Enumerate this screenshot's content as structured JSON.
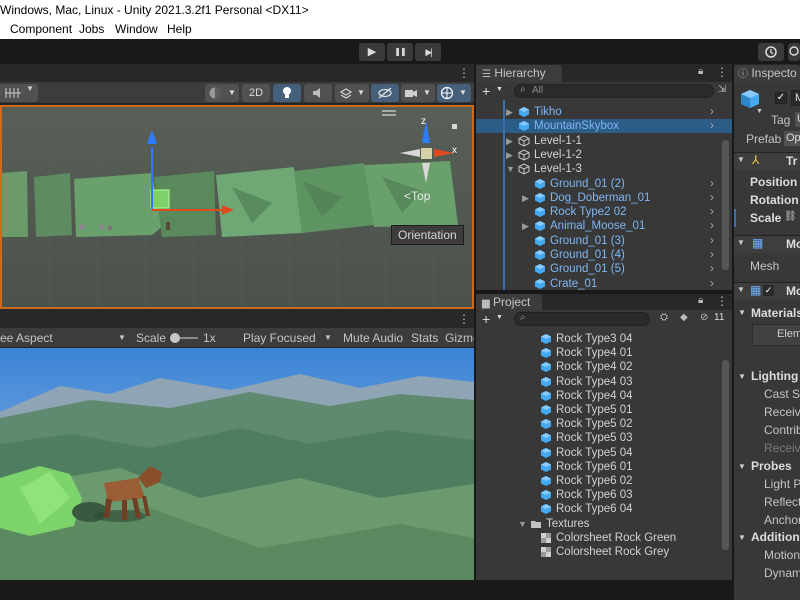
{
  "window": {
    "title": "Windows, Mac, Linux - Unity 2021.3.2f1 Personal <DX11>"
  },
  "menu": {
    "items": [
      "Component",
      "Jobs",
      "Window",
      "Help"
    ]
  },
  "playbar": {
    "play": "▶",
    "pause": "❚❚",
    "step": "▶|"
  },
  "scene": {
    "toggle_2d": "2D",
    "orientation_tooltip": "Orientation",
    "gizmo_top": "Top",
    "axis_z": "z",
    "axis_x": "x"
  },
  "game": {
    "aspect": "ee Aspect",
    "scale_label": "Scale",
    "scale_value": "1x",
    "play_focused": "Play Focused",
    "mute_audio": "Mute Audio",
    "stats": "Stats",
    "gizmos": "Gizmo"
  },
  "hierarchy": {
    "tab": "Hierarchy",
    "search_placeholder": "All",
    "rows": [
      {
        "label": "Tikho",
        "type": "prefab",
        "indent": 2,
        "expand": true,
        "chevron": true
      },
      {
        "label": "MountainSkybox",
        "type": "prefab",
        "indent": 2,
        "expand": false,
        "chevron": true,
        "selected": true
      },
      {
        "label": "Level-1-1",
        "type": "object",
        "indent": 2,
        "expand": true,
        "chevron": false
      },
      {
        "label": "Level-1-2",
        "type": "object",
        "indent": 2,
        "expand": true,
        "chevron": false
      },
      {
        "label": "Level-1-3",
        "type": "object",
        "indent": 2,
        "expand": "open",
        "chevron": false
      },
      {
        "label": "Ground_01 (2)",
        "type": "prefab",
        "indent": 3,
        "expand": false,
        "chevron": true
      },
      {
        "label": "Dog_Doberman_01",
        "type": "prefab",
        "indent": 3,
        "expand": true,
        "chevron": true
      },
      {
        "label": "Rock Type2 02",
        "type": "prefab",
        "indent": 3,
        "expand": false,
        "chevron": true
      },
      {
        "label": "Animal_Moose_01",
        "type": "prefab",
        "indent": 3,
        "expand": true,
        "chevron": true
      },
      {
        "label": "Ground_01 (3)",
        "type": "prefab",
        "indent": 3,
        "expand": false,
        "chevron": true
      },
      {
        "label": "Ground_01 (4)",
        "type": "prefab",
        "indent": 3,
        "expand": false,
        "chevron": true
      },
      {
        "label": "Ground_01 (5)",
        "type": "prefab",
        "indent": 3,
        "expand": false,
        "chevron": true
      },
      {
        "label": "Crate_01",
        "type": "prefab",
        "indent": 3,
        "expand": false,
        "chevron": true
      }
    ]
  },
  "project": {
    "tab": "Project",
    "badge": "11",
    "rows": [
      {
        "label": "Rock Type3 04",
        "kind": "prefab"
      },
      {
        "label": "Rock Type4 01",
        "kind": "prefab"
      },
      {
        "label": "Rock Type4 02",
        "kind": "prefab"
      },
      {
        "label": "Rock Type4 03",
        "kind": "prefab"
      },
      {
        "label": "Rock Type4 04",
        "kind": "prefab"
      },
      {
        "label": "Rock Type5 01",
        "kind": "prefab"
      },
      {
        "label": "Rock Type5 02",
        "kind": "prefab"
      },
      {
        "label": "Rock Type5 03",
        "kind": "prefab"
      },
      {
        "label": "Rock Type5 04",
        "kind": "prefab"
      },
      {
        "label": "Rock Type6 01",
        "kind": "prefab"
      },
      {
        "label": "Rock Type6 02",
        "kind": "prefab"
      },
      {
        "label": "Rock Type6 03",
        "kind": "prefab"
      },
      {
        "label": "Rock Type6 04",
        "kind": "prefab"
      },
      {
        "label": "Textures",
        "kind": "folder"
      },
      {
        "label": "Colorsheet Rock Green",
        "kind": "texture"
      },
      {
        "label": "Colorsheet Rock Grey",
        "kind": "texture"
      }
    ]
  },
  "inspector": {
    "tab": "Inspecto",
    "name_field": "M",
    "tag": "Tag",
    "tag_value": "U",
    "prefab": "Prefab",
    "prefab_value": "Op",
    "transform": "Tr",
    "position": "Position",
    "rotation": "Rotation",
    "scale": "Scale",
    "mesh_filter": "Mo",
    "mesh": "Mesh",
    "mesh_renderer": "Mo",
    "materials": "Materials",
    "element": "Elem",
    "lighting": "Lighting",
    "cast_shadows": "Cast Sh",
    "receive_shadows": "Receiv",
    "contribute_gi": "Contrib",
    "receive_gi": "Receiv",
    "probes": "Probes",
    "light_probes": "Light P",
    "reflection_probes": "Reflect",
    "anchor_override": "Anchor",
    "additional": "Additiona",
    "motion_vectors": "Motion",
    "dynamic_occlusion": "Dynam"
  },
  "colors": {
    "accent": "#ce6a1c",
    "blue_text": "#7eb7f5",
    "selection": "#2c5d87"
  }
}
